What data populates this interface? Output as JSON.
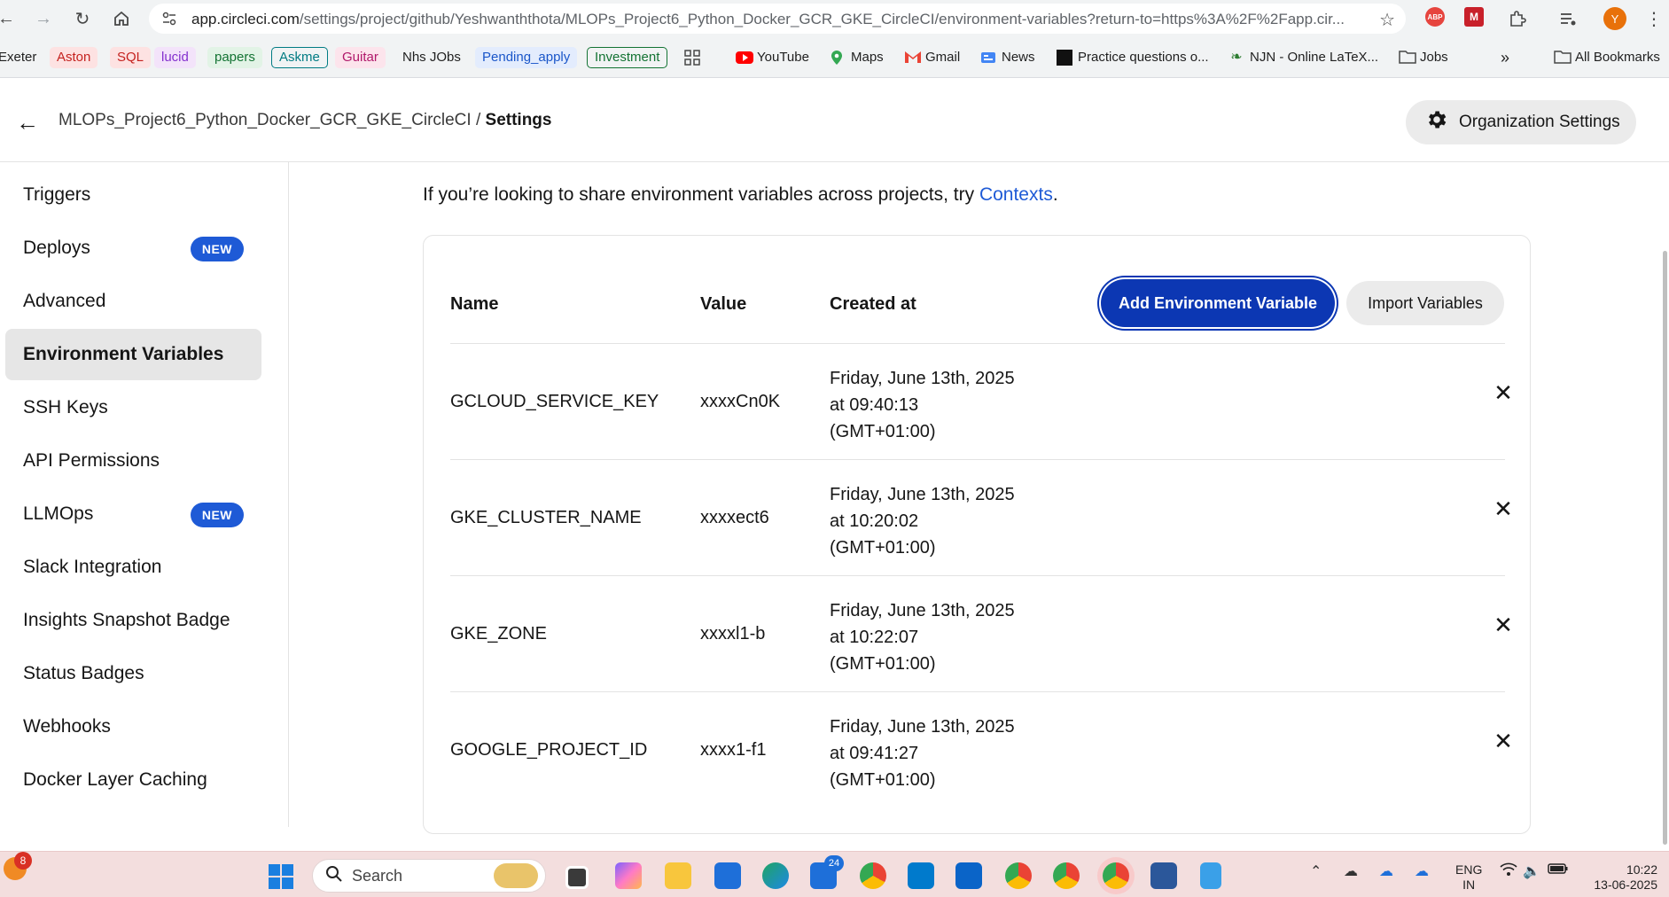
{
  "browser": {
    "url_host": "app.circleci.com",
    "url_path": "/settings/project/github/Yeshwanththota/MLOPs_Project6_Python_Docker_GCR_GKE_CircleCI/environment-variables?return-to=https%3A%2F%2Fapp.cir...",
    "profile_initial": "Y",
    "abp_label": "ABP",
    "bookmarks": [
      {
        "label": "Exeter"
      },
      {
        "label": "Aston"
      },
      {
        "label": "SQL"
      },
      {
        "label": "lucid"
      },
      {
        "label": "papers"
      },
      {
        "label": "Askme"
      },
      {
        "label": "Guitar"
      },
      {
        "label": "Nhs JObs"
      },
      {
        "label": "Pending_apply"
      },
      {
        "label": "Investment"
      },
      {
        "label": "YouTube"
      },
      {
        "label": "Maps"
      },
      {
        "label": "Gmail"
      },
      {
        "label": "News"
      },
      {
        "label": "Practice questions o..."
      },
      {
        "label": "NJN - Online LaTeX..."
      },
      {
        "label": "Jobs"
      },
      {
        "label": "All Bookmarks"
      }
    ]
  },
  "header": {
    "project": "MLOPs_Project6_Python_Docker_GCR_GKE_CircleCI",
    "separator": "/",
    "current": "Settings",
    "org_settings_label": "Organization Settings"
  },
  "sidebar": {
    "items": [
      {
        "label": "Triggers"
      },
      {
        "label": "Deploys",
        "badge": "NEW"
      },
      {
        "label": "Advanced"
      },
      {
        "label": "Environment Variables"
      },
      {
        "label": "SSH Keys"
      },
      {
        "label": "API Permissions"
      },
      {
        "label": "LLMOps",
        "badge": "NEW"
      },
      {
        "label": "Slack Integration"
      },
      {
        "label": "Insights Snapshot Badge"
      },
      {
        "label": "Status Badges"
      },
      {
        "label": "Webhooks"
      },
      {
        "label": "Docker Layer Caching"
      }
    ],
    "active_index": 3
  },
  "main": {
    "info_prefix": "If you’re looking to share environment variables across projects, try ",
    "info_link": "Contexts",
    "info_suffix": ".",
    "table": {
      "headers": {
        "name": "Name",
        "value": "Value",
        "created": "Created at"
      },
      "add_button": "Add Environment Variable",
      "import_button": "Import Variables",
      "rows": [
        {
          "name": "GCLOUD_SERVICE_KEY",
          "value": "xxxxCn0K",
          "date": "Friday, June 13th, 2025",
          "time": "at 09:40:13",
          "tz": "(GMT+01:00)"
        },
        {
          "name": "GKE_CLUSTER_NAME",
          "value": "xxxxect6",
          "date": "Friday, June 13th, 2025",
          "time": "at 10:20:02",
          "tz": "(GMT+01:00)"
        },
        {
          "name": "GKE_ZONE",
          "value": "xxxxl1-b",
          "date": "Friday, June 13th, 2025",
          "time": "at 10:22:07",
          "tz": "(GMT+01:00)"
        },
        {
          "name": "GOOGLE_PROJECT_ID",
          "value": "xxxx1-f1",
          "date": "Friday, June 13th, 2025",
          "time": "at 09:41:27",
          "tz": "(GMT+01:00)"
        }
      ]
    }
  },
  "taskbar": {
    "start_badge": "8",
    "search_placeholder": "Search",
    "mail_badge": "24",
    "lang_line1": "ENG",
    "lang_line2": "IN",
    "time": "10:22",
    "date": "13-06-2025"
  },
  "colors": {
    "accent": "#1e5ad6",
    "primary_button": "#0c37b3",
    "active_nav_bg": "#e6e6e6"
  }
}
